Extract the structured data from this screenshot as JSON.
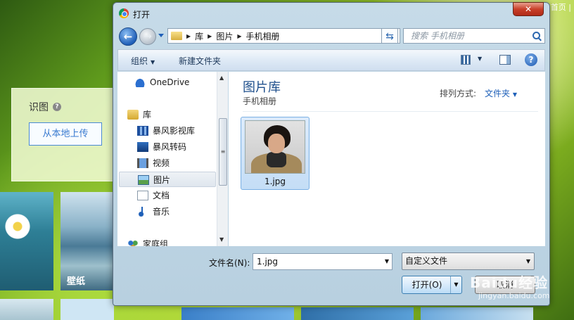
{
  "background": {
    "top_links": "收藏 | 截 | 设为首页 |",
    "shitu_label": "识图",
    "help_glyph": "?",
    "upload_button": "从本地上传",
    "wallpaper_label": "壁纸"
  },
  "dialog": {
    "title": "打开",
    "close_glyph": "✕",
    "breadcrumbs": [
      "库",
      "图片",
      "手机相册"
    ],
    "search_placeholder": "搜索 手机相册",
    "toolbar": {
      "organize": "组织",
      "new_folder": "新建文件夹"
    },
    "nav_items": [
      {
        "label": "OneDrive",
        "icon": "onedrive-icon"
      },
      {
        "label": "库",
        "icon": "library-icon"
      },
      {
        "label": "暴风影视库",
        "icon": "video-library-icon"
      },
      {
        "label": "暴风转码",
        "icon": "video-library-icon"
      },
      {
        "label": "视频",
        "icon": "video-icon"
      },
      {
        "label": "图片",
        "icon": "picture-icon",
        "selected": true
      },
      {
        "label": "文档",
        "icon": "document-icon"
      },
      {
        "label": "音乐",
        "icon": "music-icon"
      },
      {
        "label": "家庭组",
        "icon": "homegroup-icon"
      }
    ],
    "content": {
      "library_title": "图片库",
      "library_subtitle": "手机相册",
      "arrange_label": "排列方式:",
      "arrange_value": "文件夹",
      "files": [
        {
          "name": "1.jpg"
        }
      ]
    },
    "filename_label": "文件名(N):",
    "filename_value": "1.jpg",
    "filetype_value": "自定义文件",
    "open_button": "打开(O)",
    "cancel_button": "取消"
  },
  "watermark": {
    "text": "Baidu经验",
    "sub": "jingyan.baidu.com"
  },
  "colors": {
    "accent": "#1e4f8c",
    "link": "#1d5fb8"
  }
}
